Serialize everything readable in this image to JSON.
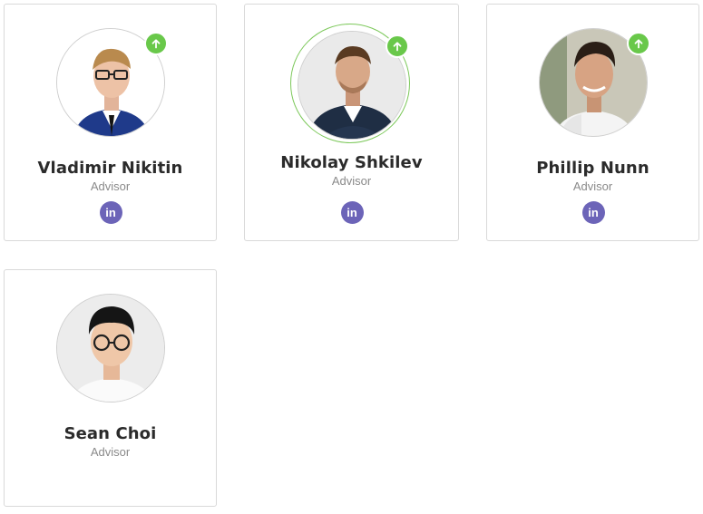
{
  "team": [
    {
      "name": "Vladimir Nikitin",
      "role": "Advisor",
      "social": "in",
      "badge_icon": "arrow-up-icon"
    },
    {
      "name": "Nikolay Shkilev",
      "role": "Advisor",
      "social": "in",
      "badge_icon": "arrow-up-icon"
    },
    {
      "name": "Phillip Nunn",
      "role": "Advisor",
      "social": "in",
      "badge_icon": "arrow-up-icon"
    },
    {
      "name": "Sean Choi",
      "role": "Advisor"
    }
  ],
  "colors": {
    "card_border": "#d9d9d9",
    "name_text": "#2b2b2b",
    "role_text": "#8a8a8a",
    "badge_green": "#69c84a",
    "linkedin_purple": "#6c64b8",
    "active_ring": "#7cc85a"
  }
}
